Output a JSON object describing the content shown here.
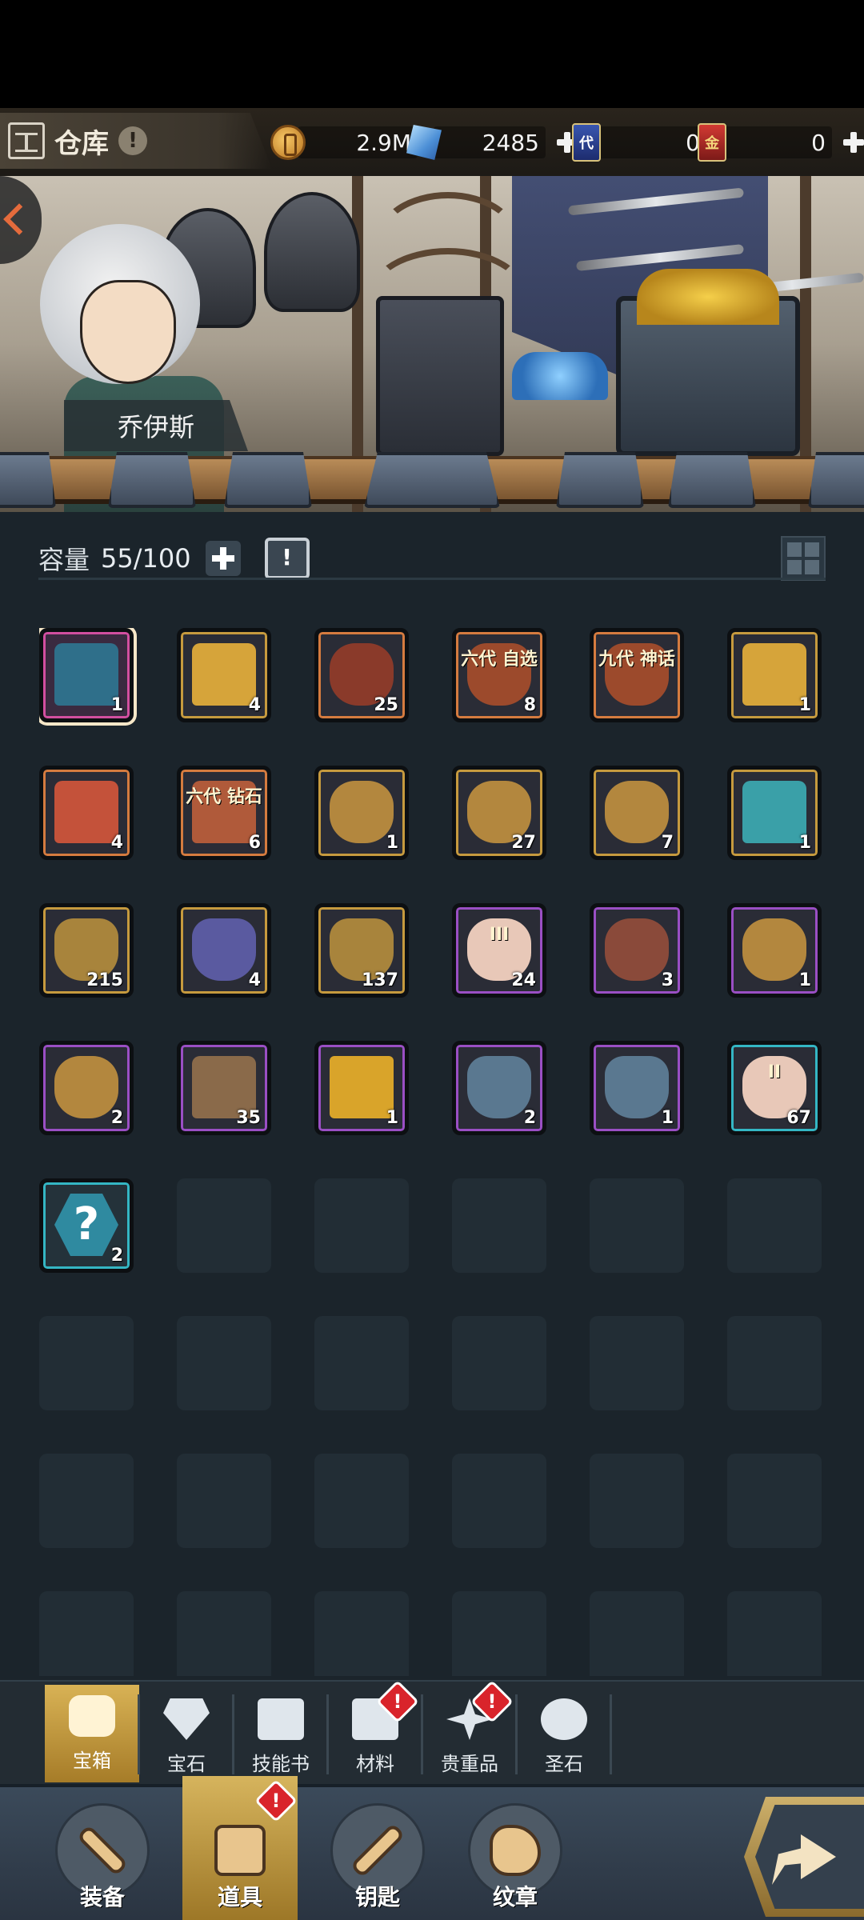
{
  "header": {
    "title": "仓库",
    "info_icon": "!",
    "resources": [
      {
        "name": "coin-icon",
        "value": "2.9M",
        "has_plus": false
      },
      {
        "name": "crystal-icon",
        "value": "2485",
        "has_plus": true
      },
      {
        "name": "card-icon",
        "label": "代",
        "value": "0",
        "has_plus": false
      },
      {
        "name": "gold-card-icon",
        "label": "金",
        "value": "0",
        "has_plus": true
      }
    ]
  },
  "banner": {
    "hero_name": "乔伊斯"
  },
  "capacity": {
    "label": "容量",
    "value": "55/100"
  },
  "items": [
    {
      "count": "1",
      "frame": "#d24fa0",
      "bg": "#3a2a40",
      "icon": "#2f6f8a",
      "shape": "chest",
      "selected": true
    },
    {
      "count": "4",
      "frame": "#c69a3e",
      "bg": "#2a2c36",
      "icon": "#d6a43a",
      "shape": "chest"
    },
    {
      "count": "25",
      "frame": "#d57b3f",
      "bg": "#2a2c36",
      "icon": "#8a3a2a",
      "shape": "bag"
    },
    {
      "count": "8",
      "frame": "#d57b3f",
      "bg": "#2a2c36",
      "icon": "#9c4a2c",
      "shape": "vase",
      "text": "六代 自选"
    },
    {
      "count": "",
      "frame": "#d57b3f",
      "bg": "#2a2c36",
      "icon": "#9c4a2c",
      "shape": "vase",
      "text": "九代 神话"
    },
    {
      "count": "1",
      "frame": "#c69a3e",
      "bg": "#2a2c36",
      "icon": "#d6a43a",
      "shape": "chest"
    },
    {
      "count": "4",
      "frame": "#d57b3f",
      "bg": "#2a2c36",
      "icon": "#c4523a",
      "shape": "chest"
    },
    {
      "count": "6",
      "frame": "#d57b3f",
      "bg": "#2a2c36",
      "icon": "#b05a3a",
      "shape": "chest",
      "text": "六代 钻石"
    },
    {
      "count": "1",
      "frame": "#c69a3e",
      "bg": "#2a2c36",
      "icon": "#b3873e",
      "shape": "bag"
    },
    {
      "count": "27",
      "frame": "#c69a3e",
      "bg": "#2a2c36",
      "icon": "#b3873e",
      "shape": "bag"
    },
    {
      "count": "7",
      "frame": "#c69a3e",
      "bg": "#2a2c36",
      "icon": "#b3873e",
      "shape": "bag"
    },
    {
      "count": "1",
      "frame": "#c69a3e",
      "bg": "#2a2c36",
      "icon": "#3aa0a8",
      "shape": "chest"
    },
    {
      "count": "215",
      "frame": "#c69a3e",
      "bg": "#2a2c36",
      "icon": "#a8843c",
      "shape": "vase"
    },
    {
      "count": "4",
      "frame": "#c69a3e",
      "bg": "#2a2c36",
      "icon": "#5a5aa0",
      "shape": "vase"
    },
    {
      "count": "137",
      "frame": "#c69a3e",
      "bg": "#2a2c36",
      "icon": "#a8843c",
      "shape": "vase"
    },
    {
      "count": "24",
      "frame": "#9a4fc4",
      "bg": "#2a2c36",
      "icon": "#e8c8b8",
      "shape": "bag",
      "text": "III"
    },
    {
      "count": "3",
      "frame": "#9a4fc4",
      "bg": "#2a2c36",
      "icon": "#8a4a3a",
      "shape": "bag"
    },
    {
      "count": "1",
      "frame": "#9a4fc4",
      "bg": "#2a2c36",
      "icon": "#b3873e",
      "shape": "bag"
    },
    {
      "count": "2",
      "frame": "#9a4fc4",
      "bg": "#2a2c36",
      "icon": "#b3873e",
      "shape": "bag"
    },
    {
      "count": "35",
      "frame": "#9a4fc4",
      "bg": "#2a2c36",
      "icon": "#8a6a4a",
      "shape": "chest"
    },
    {
      "count": "1",
      "frame": "#9a4fc4",
      "bg": "#2a2c36",
      "icon": "#d9a42a",
      "shape": "card"
    },
    {
      "count": "2",
      "frame": "#9a4fc4",
      "bg": "#2a2c36",
      "icon": "#5a7890",
      "shape": "vase"
    },
    {
      "count": "1",
      "frame": "#9a4fc4",
      "bg": "#2a2c36",
      "icon": "#5a7890",
      "shape": "vase"
    },
    {
      "count": "67",
      "frame": "#34b6c4",
      "bg": "#2a2c36",
      "icon": "#e8c8b8",
      "shape": "bag",
      "text": "II"
    },
    {
      "count": "2",
      "frame": "#34b6c4",
      "bg": "#24323a",
      "icon": "#2f8aa0",
      "shape": "hex",
      "text": "?"
    }
  ],
  "categories": [
    {
      "label": "宝箱",
      "active": true,
      "badge": ""
    },
    {
      "label": "宝石",
      "active": false,
      "badge": ""
    },
    {
      "label": "技能书",
      "active": false,
      "badge": ""
    },
    {
      "label": "材料",
      "active": false,
      "badge": "!"
    },
    {
      "label": "贵重品",
      "active": false,
      "badge": "!"
    },
    {
      "label": "圣石",
      "active": false,
      "badge": ""
    }
  ],
  "nav": [
    {
      "label": "装备",
      "active": false,
      "badge": ""
    },
    {
      "label": "道具",
      "active": true,
      "badge": "!"
    },
    {
      "label": "钥匙",
      "active": false,
      "badge": ""
    },
    {
      "label": "纹章",
      "active": false,
      "badge": ""
    }
  ]
}
